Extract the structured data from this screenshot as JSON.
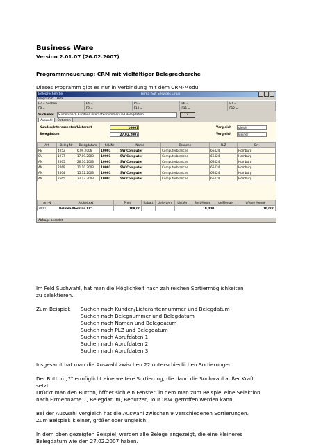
{
  "doc": {
    "title": "Business Ware",
    "version": "Version 2.01.07  (26.02.2007)",
    "heading": "Programmneuerung: CRM mit vielfältiger Belegrecherche",
    "intro_text": "Dieses Programm gibt es nur in Verbindung mit dem ",
    "intro_link": "CRM-Modul",
    "para1_line1": "Im Feld Suchwahl, hat man die Möglichkeit nach zahlreichen Sortiermöglichkeiten",
    "para1_line2": "zu selektieren.",
    "example_lead": "Zum Beispiel:",
    "examples": [
      "Suchen nach Kunden/Lieferantennummer und Belegdatum",
      "Suchen nach Belegnummer und Belegdatum",
      "Suchen nach Namen und Belegdatum",
      "Suchen nach PLZ und Belegdatum",
      "Suchen nach Abrufdaten 1",
      "Suchen nach Abrufdaten 2",
      "Suchen nach Abrufdaten 3"
    ],
    "para2": "Insgesamt hat man die Auswahl zwischen 22 unterschiedlichen Sortierungen.",
    "para3_line1": "Der Button „?\"  ermöglicht eine weitere Sortierung, die dann die Suchwahl außer Kraft",
    "para3_line2": "setzt.",
    "para3_line3": "Drückt man den Button, öffnet sich ein Fenster, in dem man zum Beispiel eine Selektion",
    "para3_line4": "nach Firmenname 1, Belegdatum, Benutzer, Tour usw. getroffen werden kann.",
    "para4_line1": "Bei der Auswahl Vergleich hat die Auswahl zwischen 9 verschiedenen Sortierungen.",
    "para4_line2": "Zum Beispiel: kleiner, größer oder ungleich.",
    "para5_line1": "In dem oben gezeigten Beispiel, werden alle Belege angezeigt, die eine kleineres",
    "para5_line2": "Belegdatum wie den 27.02.2007 haben."
  },
  "app": {
    "window_title": "Belegrecherche",
    "window_title_right": "Firma: SW Services Linux",
    "menu": [
      "Programm",
      "Hilfe"
    ],
    "fkeys_row1": [
      "F2 = Suchen",
      "F4 =",
      "F5 =",
      "F6 =",
      "F7 ="
    ],
    "fkeys_row2": [
      "F8 =",
      "F9 =",
      "F10 =",
      "F11 =",
      "F12 ="
    ],
    "suchwahl_label": "Suchwahl",
    "suchwahl_value": "Suchen nach Kunden/Lieferantennummer und Belegdatum",
    "question_button": "?",
    "tabs": [
      "Auswahl",
      "Optionen"
    ],
    "filter": {
      "kunden_label": "Kunden/Interessenten/Lieferant",
      "kunden_value": "10001",
      "beleg_label": "Belegdatum",
      "beleg_value": "27.02.2007",
      "vergleich_label": "Vergleich",
      "vergleich1": "gleich",
      "vergleich2": "kleiner"
    },
    "grid1_headers": [
      "Art",
      "Beleg-Nr",
      "Belegdatum",
      "KdLiNr",
      "Name",
      "Branche",
      "PLZ",
      "Ort"
    ],
    "grid1_rows": [
      [
        "RE",
        "4052",
        "6.09.2006",
        "10001",
        "SW Computer",
        "Computerbranche",
        "66424",
        "Homburg"
      ],
      [
        "GU",
        "1977",
        "17.09.2003",
        "10001",
        "SW Computer",
        "Computerbranche",
        "66424",
        "Homburg"
      ],
      [
        "AN",
        "2565",
        "26.10.2003",
        "10001",
        "SW Computer",
        "Computerbranche",
        "66424",
        "Homburg"
      ],
      [
        "AN",
        "2469",
        "11.10.2003",
        "10001",
        "SW Computer",
        "Computerbranche",
        "66424",
        "Homburg"
      ],
      [
        "AN",
        "2504",
        "15.12.2003",
        "10001",
        "SW Computer",
        "Computerbranche",
        "66424",
        "Homburg"
      ],
      [
        "AN",
        "2565",
        "22.12.2003",
        "10001",
        "SW Computer",
        "Computerbranche",
        "66424",
        "Homburg"
      ]
    ],
    "grid2_headers": [
      "Art-Nr",
      "Artikeltext",
      "Preis",
      "Rabatt",
      "Lieferterm",
      "ListVer",
      "BestMenge",
      "gelMenge",
      "offene Menge"
    ],
    "grid2_rows": [
      [
        "2000",
        "Belinea Monitor 17\"",
        "109,00",
        "",
        "",
        "",
        "10,000",
        "",
        "10,000"
      ]
    ],
    "status": "Abfrage beendet"
  }
}
